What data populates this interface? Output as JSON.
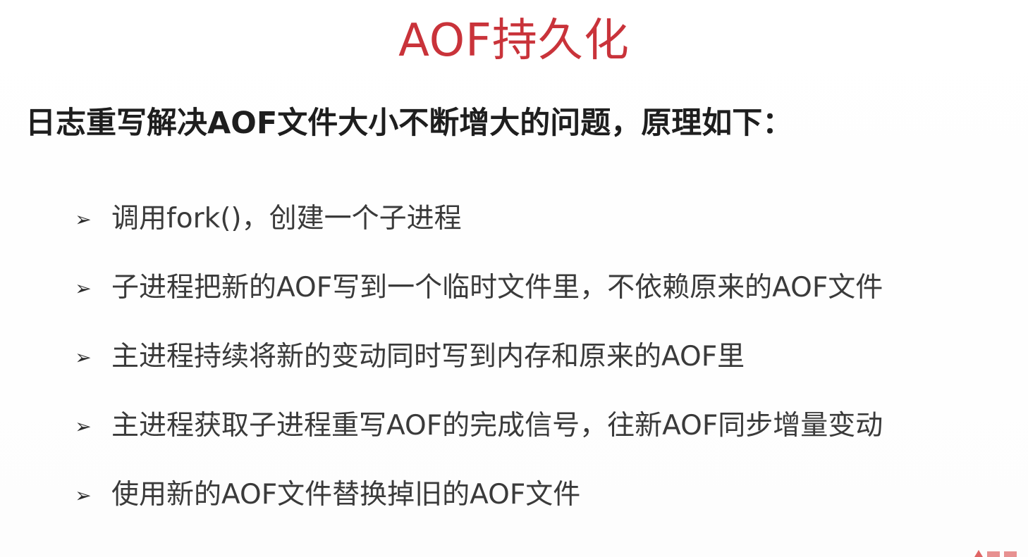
{
  "title": "AOF持久化",
  "subtitle": "日志重写解决AOF文件大小不断增大的问题，原理如下：",
  "bullet_icon": "arrow-bullet-icon",
  "bullets": [
    "调用fork()，创建一个子进程",
    "子进程把新的AOF写到一个临时文件里，不依赖原来的AOF文件",
    "主进程持续将新的变动同时写到内存和原来的AOF里",
    "主进程获取子进程重写AOF的完成信号，往新AOF同步增量变动",
    "使用新的AOF文件替换掉旧的AOF文件"
  ],
  "colors": {
    "title": "#c9333a",
    "text": "#1e1e1e",
    "watermark": "#d94a4a"
  }
}
